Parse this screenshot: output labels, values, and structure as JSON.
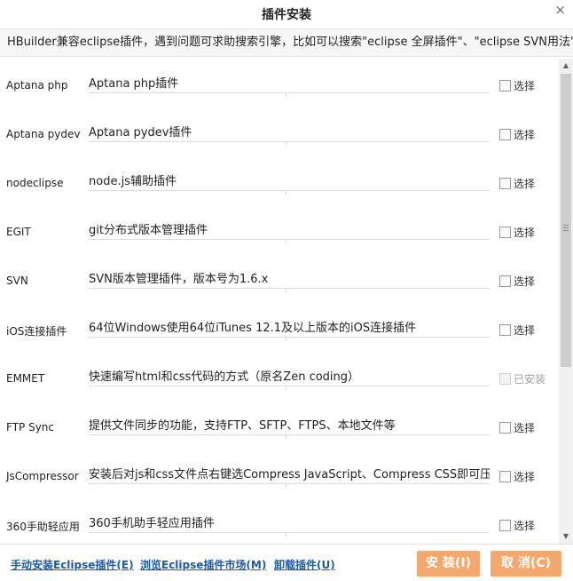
{
  "dialog": {
    "title": "插件安装",
    "close_glyph": "×",
    "hint": "HBuilder兼容eclipse插件，遇到问题可求助搜索引擎，比如可以搜索\"eclipse 全屏插件\"、\"eclipse SVN用法\""
  },
  "plugins": [
    {
      "name": "Aptana php",
      "desc": "Aptana php插件",
      "status": "选择",
      "installed": false
    },
    {
      "name": "Aptana pydev",
      "desc": "Aptana pydev插件",
      "status": "选择",
      "installed": false
    },
    {
      "name": "nodeclipse",
      "desc": "node.js辅助插件",
      "status": "选择",
      "installed": false
    },
    {
      "name": "EGIT",
      "desc": "git分布式版本管理插件",
      "status": "选择",
      "installed": false
    },
    {
      "name": "SVN",
      "desc": "SVN版本管理插件，版本号为1.6.x",
      "status": "选择",
      "installed": false
    },
    {
      "name": "iOS连接插件",
      "desc": "64位Windows使用64位iTunes 12.1及以上版本的iOS连接插件",
      "status": "选择",
      "installed": false
    },
    {
      "name": "EMMET",
      "desc": "快速编写html和css代码的方式（原名Zen coding）",
      "status": "已安装",
      "installed": true
    },
    {
      "name": "FTP Sync",
      "desc": "提供文件同步的功能，支持FTP、SFTP、FTPS、本地文件等",
      "status": "选择",
      "installed": false
    },
    {
      "name": "JsCompressor",
      "desc": "安装后对js和css文件点右键选Compress JavaScript、Compress CSS即可压缩",
      "status": "选择",
      "installed": false
    },
    {
      "name": "360手助轻应用",
      "desc": "360手机助手轻应用插件",
      "status": "选择",
      "installed": false
    }
  ],
  "footer": {
    "link_manual": "手动安装Eclipse插件(E)",
    "link_market": "浏览Eclipse插件市场(M)",
    "link_uninstall": "卸载插件(U)",
    "install_btn": "安 装(I)",
    "cancel_btn": "取 消(C)"
  },
  "colors": {
    "button_bg": "#f5a86d",
    "link": "#1a5aa8"
  }
}
